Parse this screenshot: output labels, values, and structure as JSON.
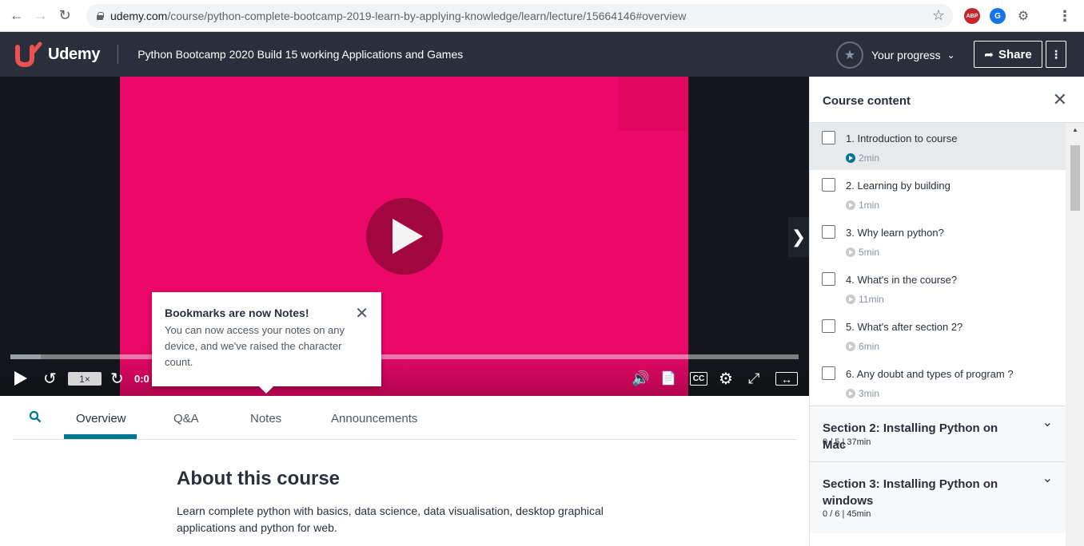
{
  "browser": {
    "url_domain": "udemy.com",
    "url_path": "/course/python-complete-bootcamp-2019-learn-by-applying-knowledge/learn/lecture/15664146#overview",
    "ext_abp": "ABP",
    "ext_g": "G"
  },
  "header": {
    "logo_text": "Udemy",
    "course_title": "Python Bootcamp 2020 Build 15 working Applications and Games",
    "progress_label": "Your progress",
    "share_label": "Share"
  },
  "player": {
    "speed": "1×",
    "time": "0:0",
    "cc": "CC"
  },
  "tooltip": {
    "title": "Bookmarks are now Notes!",
    "body": "You can now access your notes on any device, and we've raised the character count."
  },
  "tabs": [
    "Overview",
    "Q&A",
    "Notes",
    "Announcements"
  ],
  "about": {
    "title": "About this course",
    "text": "Learn complete python with basics, data science, data visualisation, desktop graphical applications and python for web."
  },
  "sidebar": {
    "title": "Course content",
    "lectures": [
      {
        "title": "1. Introduction to course",
        "duration": "2min"
      },
      {
        "title": "2. Learning by building",
        "duration": "1min"
      },
      {
        "title": "3. Why learn python?",
        "duration": "5min"
      },
      {
        "title": "4. What's in the course?",
        "duration": "11min"
      },
      {
        "title": "5. What's after section 2?",
        "duration": "6min"
      },
      {
        "title": "6. Any doubt and types of program ?",
        "duration": "3min"
      }
    ],
    "sections": [
      {
        "title": "Section 2: Installing Python on Mac",
        "meta": "0 / 5 | 37min"
      },
      {
        "title": "Section 3: Installing Python on windows",
        "meta": "0 / 6 | 45min"
      }
    ]
  },
  "colors": {
    "brand": "#ec5252",
    "header_bg": "#29303b",
    "video_bg": "#ec0868",
    "accent": "#007791"
  }
}
